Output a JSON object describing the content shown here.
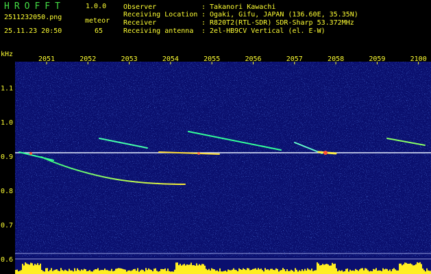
{
  "app": {
    "title": "HROFFT",
    "version": "1.0.0",
    "file_name": "2511232050.png",
    "datetime": "25.11.23 20:50",
    "meteor_label": "meteor",
    "meteor_count": "65"
  },
  "info": {
    "observer_key": "Observer",
    "observer_val": ": Takanori Kawachi",
    "location_key": "Receiving Location",
    "location_val": ": Ogaki, Gifu, JAPAN (136.60E, 35.35N)",
    "receiver_key": "Receiver",
    "receiver_val": ": R820T2(RTL-SDR) SDR-Sharp 53.372MHz",
    "antenna_key": "Receiving antenna",
    "antenna_val": ": 2el-HB9CV Vertical (el. E-W)"
  },
  "spectrogram": {
    "unit": "kHz",
    "time_labels": [
      "2051",
      "2052",
      "2053",
      "2054",
      "2055",
      "2056",
      "2057",
      "2058",
      "2059",
      "2100"
    ],
    "freq_labels": [
      "1.1",
      "1.0",
      "0.9",
      "0.8",
      "0.7",
      "0.6"
    ],
    "colors": {
      "background": "#0a0f6e",
      "axis_text": "#ffff33",
      "carrier": "#e8f0ff"
    }
  }
}
